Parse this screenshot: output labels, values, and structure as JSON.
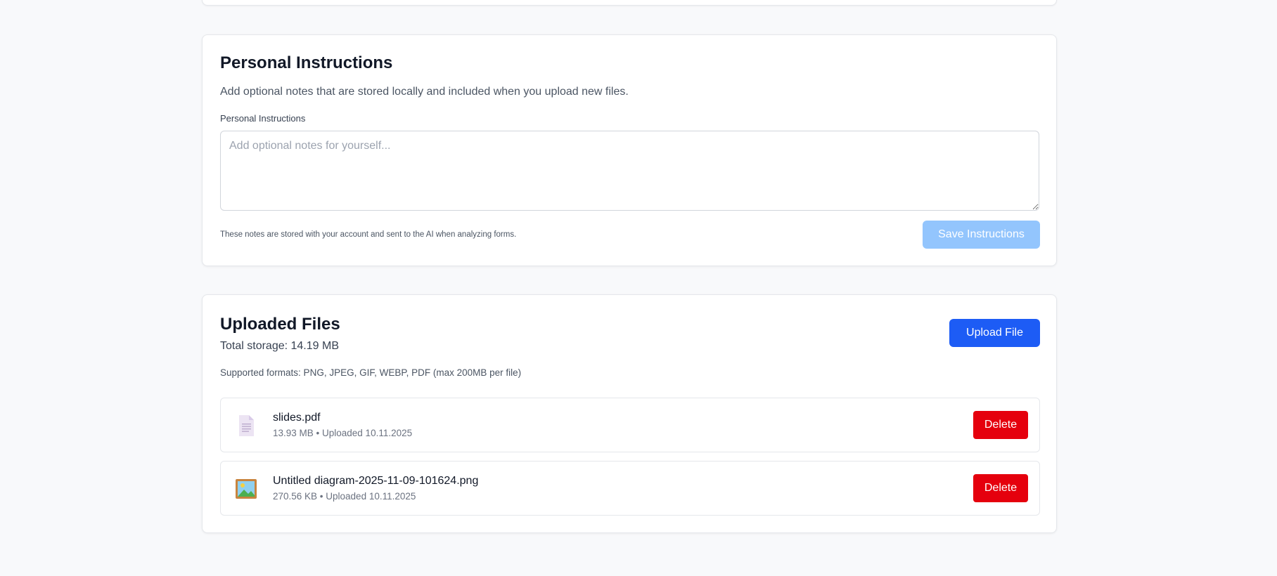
{
  "instructions_section": {
    "title": "Personal Instructions",
    "description": "Add optional notes that are stored locally and included when you upload new files.",
    "field_label": "Personal Instructions",
    "textarea_value": "",
    "textarea_placeholder": "Add optional notes for yourself...",
    "helper_text": "These notes are stored with your account and sent to the AI when analyzing forms.",
    "save_label": "Save Instructions",
    "save_disabled": true
  },
  "files_section": {
    "title": "Uploaded Files",
    "total_storage": "Total storage: 14.19 MB",
    "supported_formats": "Supported formats: PNG, JPEG, GIF, WEBP, PDF (max 200MB per file)",
    "upload_label": "Upload File",
    "files": [
      {
        "name": "slides.pdf",
        "meta": "13.93 MB • Uploaded 10.11.2025",
        "icon": "document-icon",
        "delete_label": "Delete"
      },
      {
        "name": "Untitled diagram-2025-11-09-101624.png",
        "meta": "270.56 KB • Uploaded 10.11.2025",
        "icon": "framed-picture-icon",
        "delete_label": "Delete"
      }
    ]
  },
  "colors": {
    "primary": "#1d5cf5",
    "primary_disabled": "#93c5fd",
    "danger": "#e5000d",
    "background": "#f8f9fb"
  }
}
